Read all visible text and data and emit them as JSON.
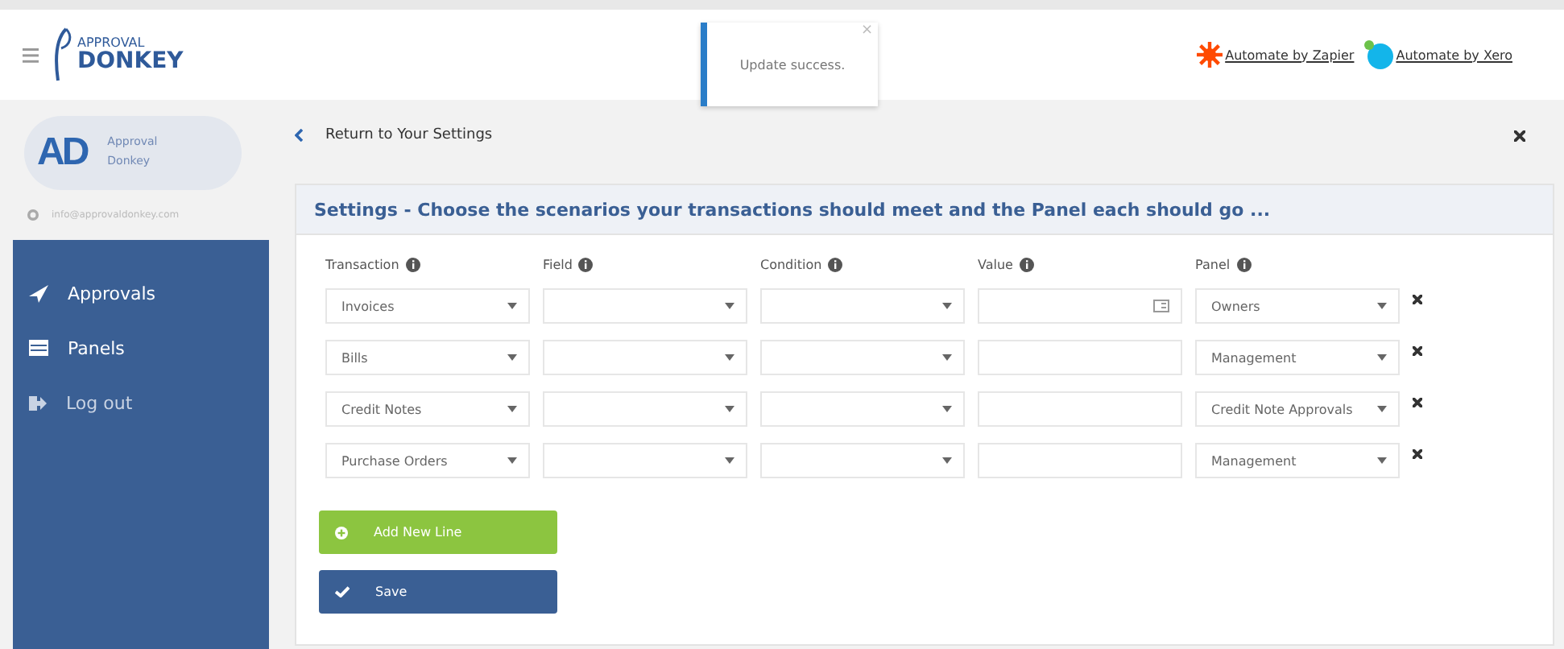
{
  "header": {
    "logo_top": "APPROVAL",
    "logo_bottom": "DONKEY",
    "links": [
      {
        "kind": "zapier",
        "label": "Automate by Zapier"
      },
      {
        "kind": "xero",
        "label": "Automate by Xero"
      }
    ]
  },
  "toast": {
    "message": "Update success.",
    "close": "×"
  },
  "sidebar": {
    "avatar": "AD",
    "name": "Approval Donkey",
    "email": "info@approvaldonkey.com",
    "items": [
      {
        "kind": "approvals",
        "label": "Approvals"
      },
      {
        "kind": "panels",
        "label": "Panels"
      },
      {
        "kind": "logout",
        "label": "Log out"
      }
    ]
  },
  "back_link": "Return to Your Settings",
  "card": {
    "title": "Settings - Choose the scenarios your transactions should meet and the Panel each should go ...",
    "columns": [
      "Transaction",
      "Field",
      "Condition",
      "Value",
      "Panel"
    ],
    "rows": [
      {
        "transaction": "Invoices",
        "value_picker": true,
        "panel": "Owners"
      },
      {
        "transaction": "Bills",
        "value_picker": false,
        "panel": "Management"
      },
      {
        "transaction": "Credit Notes",
        "value_picker": false,
        "panel": "Credit Note Approvals"
      },
      {
        "transaction": "Purchase Orders",
        "value_picker": false,
        "panel": "Management"
      }
    ]
  },
  "buttons": [
    {
      "kind": "add",
      "label": "Add New Line"
    },
    {
      "kind": "save",
      "label": "Save"
    }
  ]
}
